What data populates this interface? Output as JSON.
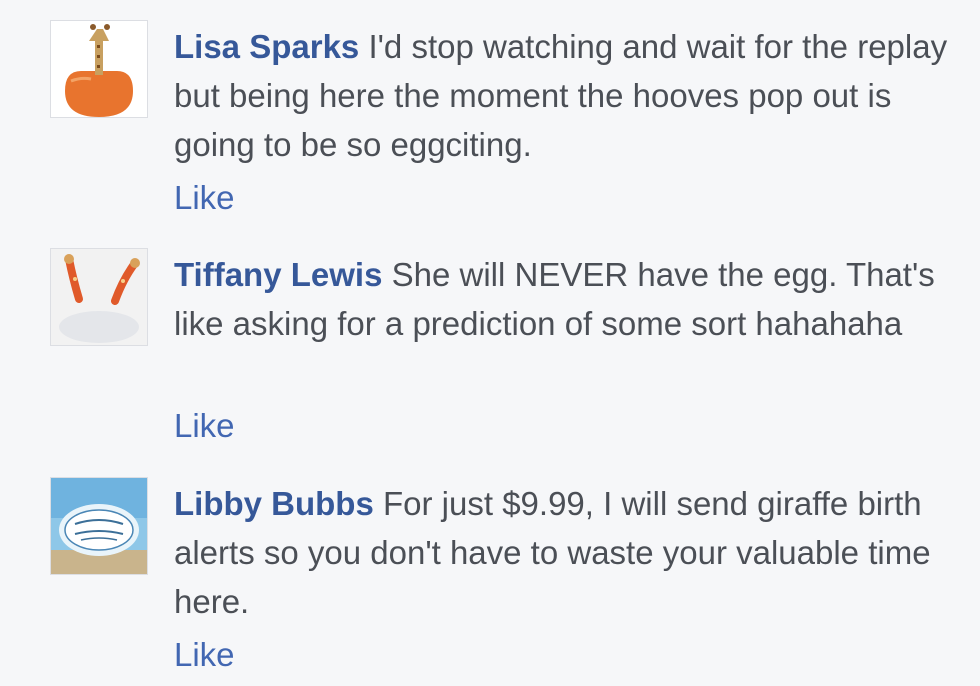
{
  "comments": [
    {
      "author": "Lisa Sparks",
      "text": "I'd stop watching and wait for the replay but being here the moment the hooves pop out is going to be so eggciting.",
      "like_label": "Like",
      "avatar_icon": "giraffe-in-egg-avatar"
    },
    {
      "author": "Tiffany Lewis",
      "text": "She will NEVER have the egg. That's like asking for a prediction of some sort hahahaha",
      "like_label": "Like",
      "avatar_icon": "giraffe-figures-avatar"
    },
    {
      "author": "Libby Bubbs",
      "text": "For just $9.99, I will send giraffe birth alerts so you don't have to waste your valuable time here.",
      "like_label": "Like",
      "avatar_icon": "beach-sign-avatar"
    }
  ],
  "colors": {
    "background": "#f6f7f9",
    "author": "#365899",
    "text": "#4b4f56",
    "like": "#4267b2"
  }
}
